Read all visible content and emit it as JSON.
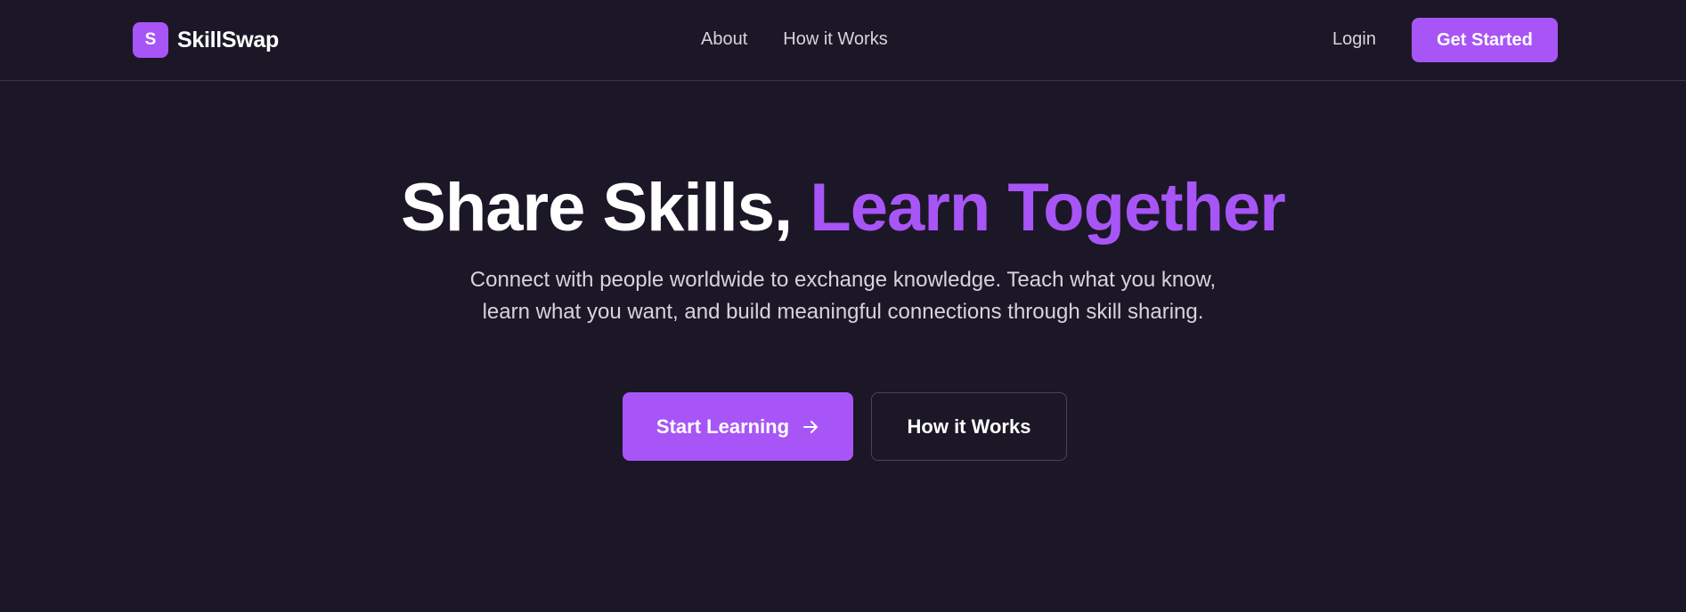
{
  "header": {
    "logo_letter": "S",
    "brand": "SkillSwap",
    "nav": [
      {
        "label": "About"
      },
      {
        "label": "How it Works"
      }
    ],
    "login_label": "Login",
    "cta_label": "Get Started"
  },
  "hero": {
    "title_part1": "Share Skills, ",
    "title_part2": "Learn Together",
    "subtitle": "Connect with people worldwide to exchange knowledge. Teach what you know, learn what you want, and build meaningful connections through skill sharing.",
    "primary_button": "Start Learning",
    "primary_button_icon": "arrow-right-icon",
    "secondary_button": "How it Works"
  },
  "colors": {
    "background": "#1c1726",
    "accent": "#a855f7",
    "muted_text": "#d6d3dd",
    "border": "#3a3446"
  }
}
